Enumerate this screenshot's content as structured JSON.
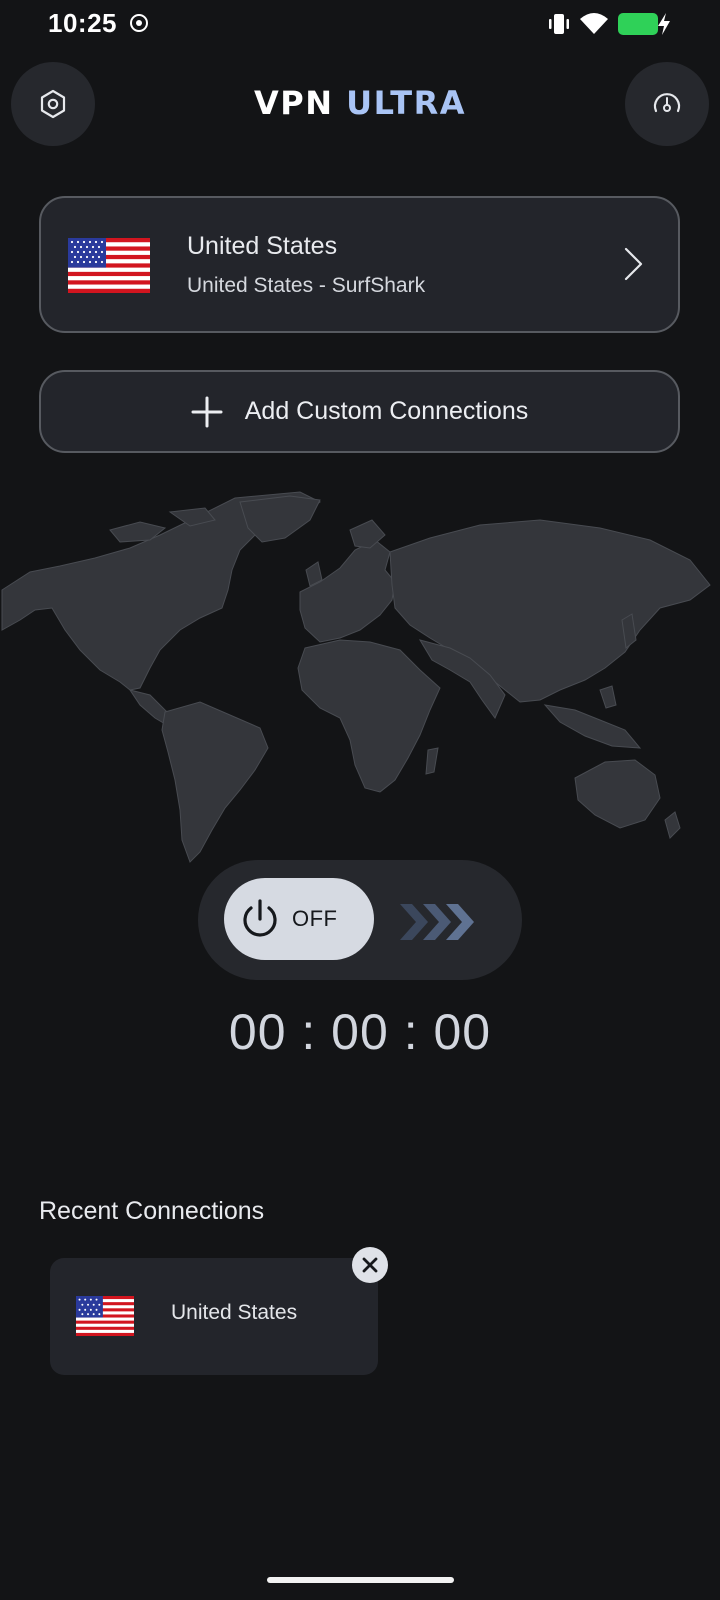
{
  "status_bar": {
    "time": "10:25",
    "icons": [
      "record-icon",
      "vibrate-icon",
      "wifi-icon",
      "battery-charging-icon"
    ],
    "battery_color": "#2fd158"
  },
  "header": {
    "title_part1": "VPN",
    "title_part2": "ULTRA",
    "title_accent_color": "#a9c4f5",
    "left_button_icon": "hexagon-settings-icon",
    "right_button_icon": "speedometer-icon"
  },
  "server": {
    "country": "United States",
    "subtitle": "United States - SurfShark",
    "flag_icon": "us-flag-icon"
  },
  "add_custom": {
    "label": "Add Custom Connections",
    "icon": "plus-icon"
  },
  "connect": {
    "state_label": "OFF",
    "icon": "power-icon",
    "arrows_icon": "triple-chevron-right-icon"
  },
  "timer": {
    "value": "00 : 00 : 00"
  },
  "recent": {
    "title": "Recent Connections",
    "items": [
      {
        "country": "United States",
        "flag_icon": "us-flag-icon"
      }
    ]
  },
  "colors": {
    "background": "#131416",
    "card": "#23252b",
    "card_border": "#575a60",
    "knob": "#d6dae2",
    "arrows": "#5a6a85"
  }
}
